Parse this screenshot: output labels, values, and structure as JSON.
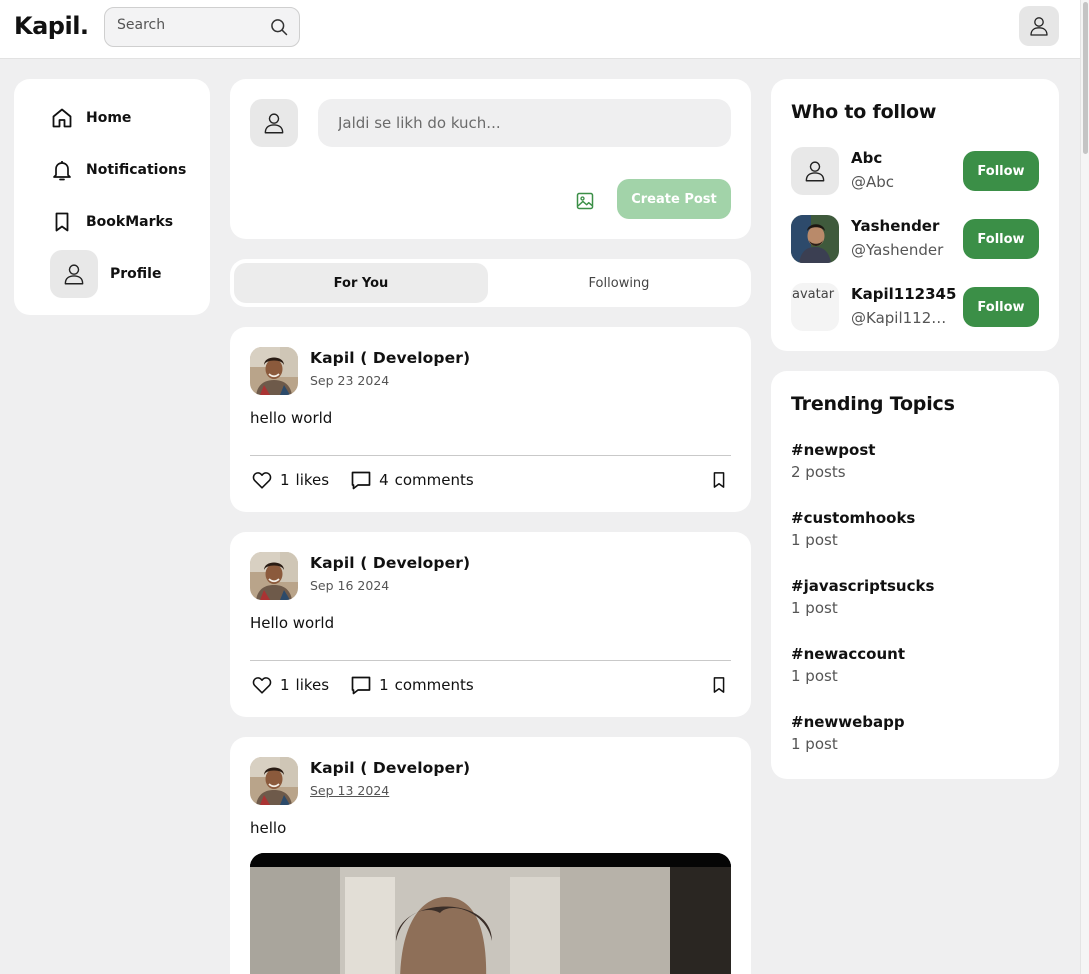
{
  "header": {
    "logo": "Kapil.",
    "search_placeholder": "Search"
  },
  "nav": {
    "items": [
      {
        "label": "Home",
        "icon": "home-icon"
      },
      {
        "label": "Notifications",
        "icon": "bell-icon"
      },
      {
        "label": "BookMarks",
        "icon": "bookmark-icon"
      },
      {
        "label": "Profile",
        "icon": "user-icon"
      }
    ]
  },
  "composer": {
    "placeholder": "Jaldi se likh do kuch...",
    "create_label": "Create Post"
  },
  "tabs": {
    "for_you": "For You",
    "following": "Following"
  },
  "posts": [
    {
      "author": "Kapil ( Developer)",
      "date": "Sep 23 2024",
      "text": "hello world",
      "likes": "1",
      "likes_label": "likes",
      "comments": "4",
      "comments_label": "comments"
    },
    {
      "author": "Kapil ( Developer)",
      "date": "Sep 16 2024",
      "text": "Hello world",
      "likes": "1",
      "likes_label": "likes",
      "comments": "1",
      "comments_label": "comments"
    },
    {
      "author": "Kapil ( Developer)",
      "date": "Sep 13 2024",
      "text": "hello"
    }
  ],
  "who_to_follow": {
    "title": "Who to follow",
    "users": [
      {
        "name": "Abc",
        "handle": "@Abc",
        "button": "Follow"
      },
      {
        "name": "Yashender",
        "handle": "@Yashender",
        "button": "Follow"
      },
      {
        "name": "Kapil112345",
        "handle": "@Kapil112345",
        "button": "Follow",
        "avatar_alt": "avatar"
      }
    ]
  },
  "trending": {
    "title": "Trending Topics",
    "topics": [
      {
        "tag": "#newpost",
        "count": "2 posts"
      },
      {
        "tag": "#customhooks",
        "count": "1 post"
      },
      {
        "tag": "#javascriptsucks",
        "count": "1 post"
      },
      {
        "tag": "#newaccount",
        "count": "1 post"
      },
      {
        "tag": "#newwebapp",
        "count": "1 post"
      }
    ]
  },
  "colors": {
    "accent": "#3b8f47",
    "accent_disabled": "#a2d3a9",
    "page_bg": "#efeff0"
  }
}
